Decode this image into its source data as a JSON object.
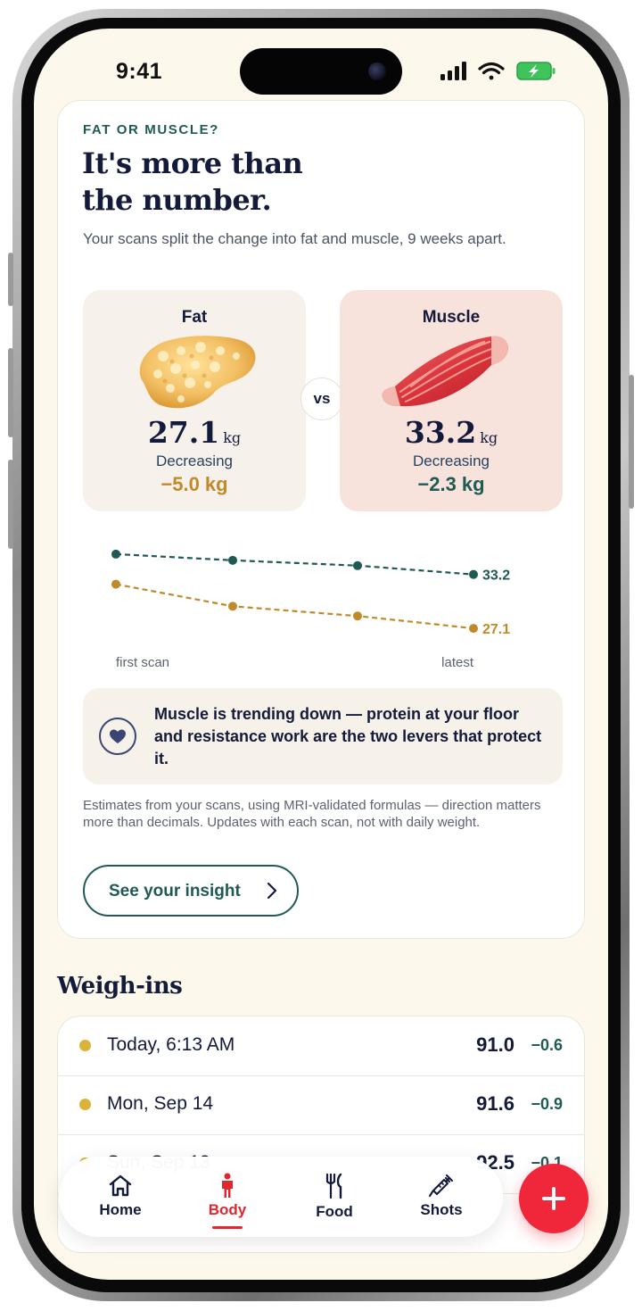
{
  "status": {
    "time": "9:41"
  },
  "card": {
    "eyebrow": "FAT OR MUSCLE?",
    "headline_line1": "It's more than",
    "headline_line2": "the number.",
    "subtext": "Your scans split the change into fat and muscle, 9 weeks apart.",
    "vs_label": "vs",
    "fat": {
      "title": "Fat",
      "value": "27.1",
      "unit": "kg",
      "trend": "Decreasing",
      "delta": "−5.0 kg",
      "color": "#c08a2a"
    },
    "muscle": {
      "title": "Muscle",
      "value": "33.2",
      "unit": "kg",
      "trend": "Decreasing",
      "delta": "−2.3 kg",
      "color": "#1f5a55"
    },
    "chart_labels": {
      "start": "first scan",
      "end": "latest"
    },
    "callout_icon": "heart-icon",
    "callout": "Muscle is trending down — protein at your floor and resistance work are the two levers that protect it.",
    "footnote": "Estimates from your scans, using MRI-validated formulas — direction matters more than decimals. Updates with each scan, not with daily weight.",
    "insight_button": "See your insight"
  },
  "chart_data": {
    "type": "line",
    "x": [
      "first scan",
      "",
      "",
      "latest"
    ],
    "series": [
      {
        "values": [
          35.5,
          34.8,
          34.2,
          33.2
        ],
        "color": "#1f5a55",
        "end_label": "33.2"
      },
      {
        "values": [
          32.1,
          29.6,
          28.5,
          27.1
        ],
        "color": "#c08a2a",
        "end_label": "27.1"
      }
    ]
  },
  "weighins": {
    "title": "Weigh-ins",
    "rows": [
      {
        "date": "Today, 6:13 AM",
        "weight": "91.0",
        "change": "−0.6"
      },
      {
        "date": "Mon, Sep 14",
        "weight": "91.6",
        "change": "−0.9"
      },
      {
        "date": "Sun, Sep 13",
        "weight": "92.5",
        "change": "−0.1"
      }
    ]
  },
  "nav": {
    "items": [
      {
        "label": "Home",
        "icon": "home-icon"
      },
      {
        "label": "Body",
        "icon": "body-icon",
        "active": true
      },
      {
        "label": "Food",
        "icon": "fork-knife-icon"
      },
      {
        "label": "Shots",
        "icon": "syringe-icon"
      }
    ],
    "fab_icon": "plus-icon",
    "accent": "#e0262f"
  }
}
